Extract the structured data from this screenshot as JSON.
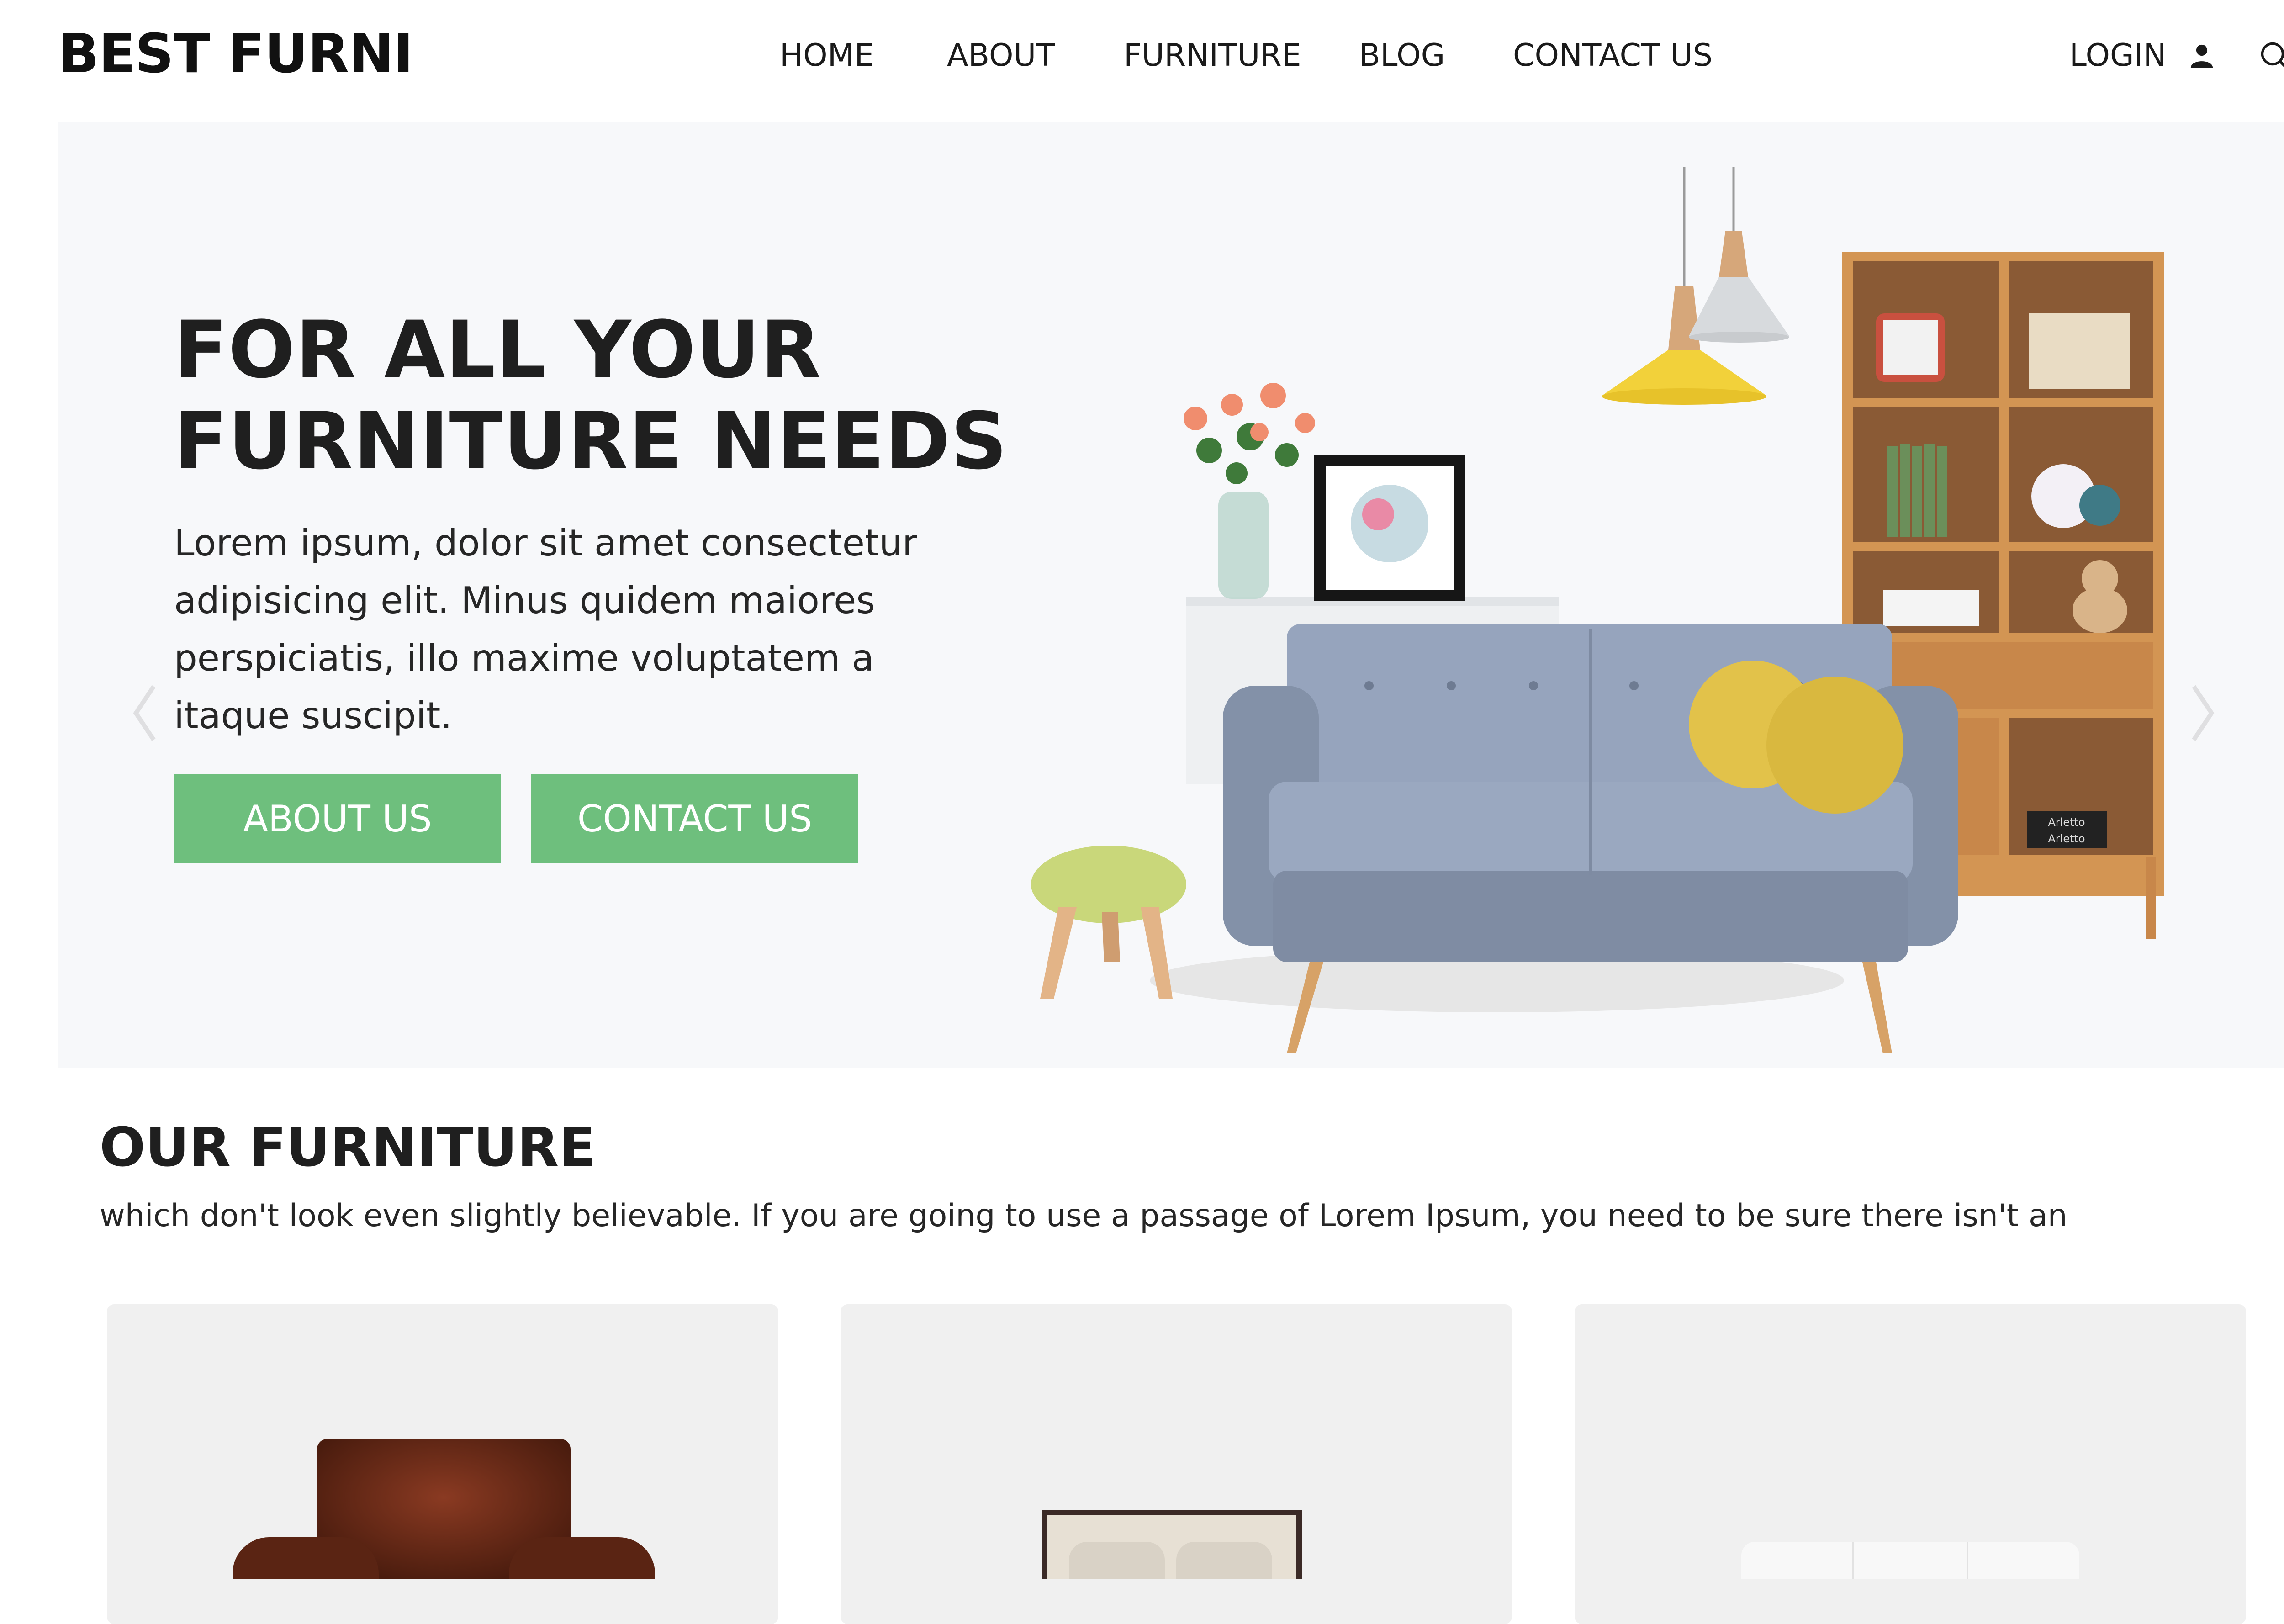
{
  "header": {
    "brand": "BEST FURNI",
    "nav": [
      "HOME",
      "ABOUT",
      "FURNITURE",
      "BLOG",
      "CONTACT US"
    ],
    "login_label": "LOGIN",
    "icons": [
      "user-icon",
      "search-icon"
    ]
  },
  "hero": {
    "title_line1": "FOR ALL YOUR",
    "title_line2": "FURNITURE NEEDS",
    "text": "Lorem ipsum, dolor sit amet consectetur adipisicing elit. Minus quidem maiores perspiciatis, illo maxime voluptatem a itaque suscipit.",
    "buttons": [
      "ABOUT US",
      "CONTACT US"
    ],
    "shelf_labels": [
      "Arletto",
      "Arletto"
    ]
  },
  "section": {
    "title": "OUR FURNITURE",
    "text": "which don't look even slightly believable. If you are going to use a passage of Lorem Ipsum, you need to be sure there isn't an"
  },
  "colors": {
    "accent": "#6ebf7d",
    "hero_bg": "#f7f8fa",
    "card_bg": "#f0f0f0"
  }
}
